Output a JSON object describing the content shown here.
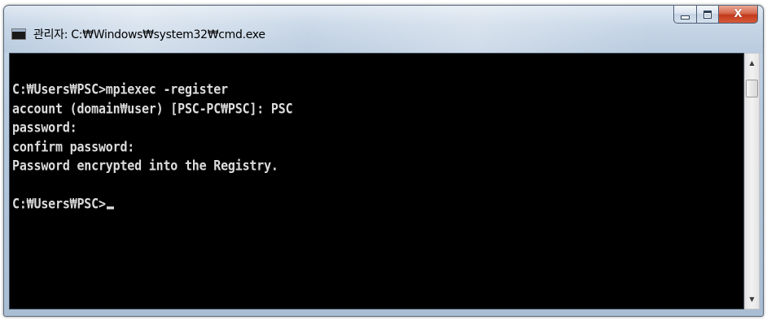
{
  "window": {
    "title": "관리자: C:₩Windows₩system32₩cmd.exe",
    "icon": "cmd-icon",
    "icon_text": "C:\\",
    "buttons": {
      "minimize_icon": "minimize-icon",
      "maximize_icon": "maximize-icon",
      "close_icon": "close-icon",
      "close_glyph": "X"
    }
  },
  "console": {
    "lines": [
      "",
      "C:₩Users₩PSC>mpiexec -register",
      "account (domain₩user) [PSC-PC₩PSC]: PSC",
      "password:",
      "confirm password:",
      "Password encrypted into the Registry.",
      "",
      "C:₩Users₩PSC>"
    ],
    "foreground": "#dcdcdc",
    "background": "#000000"
  },
  "scrollbar": {
    "up_glyph": "▲",
    "down_glyph": "▼"
  },
  "colors": {
    "close_button": "#c2391b",
    "titlebar": "#c8d7e7"
  }
}
